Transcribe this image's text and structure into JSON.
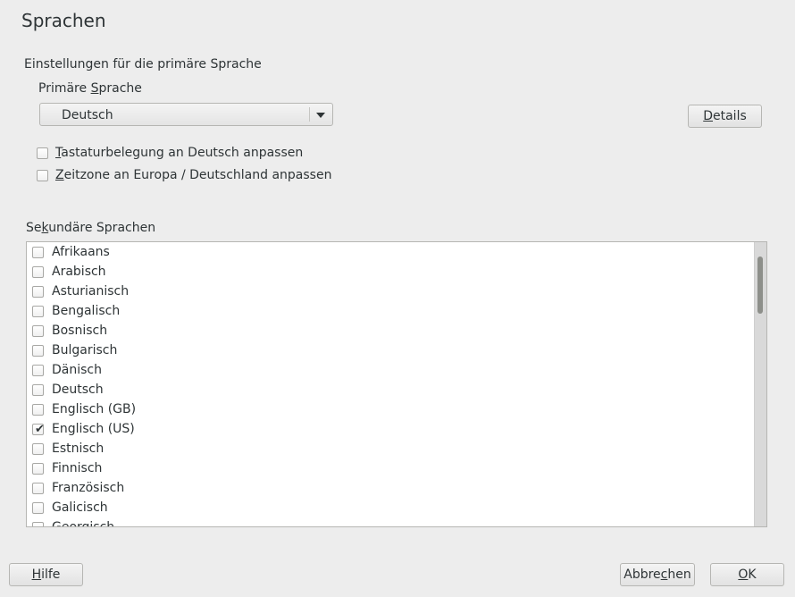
{
  "page": {
    "title": "Sprachen",
    "section_label": "Einstellungen für die primäre Sprache"
  },
  "primary": {
    "label_pre": "Primäre ",
    "label_u": "S",
    "label_post": "prache",
    "selected": "Deutsch",
    "details_u": "D",
    "details_rest": "etails"
  },
  "options": {
    "keyboard": {
      "u": "T",
      "rest": "astaturbelegung an Deutsch anpassen",
      "checked": false
    },
    "timezone": {
      "u": "Z",
      "rest": "eitzone an Europa / Deutschland anpassen",
      "checked": false
    }
  },
  "secondary": {
    "label_pre": "Se",
    "label_u": "k",
    "label_post": "undäre Sprachen",
    "items": [
      {
        "label": "Afrikaans",
        "checked": false
      },
      {
        "label": "Arabisch",
        "checked": false
      },
      {
        "label": "Asturianisch",
        "checked": false
      },
      {
        "label": "Bengalisch",
        "checked": false
      },
      {
        "label": "Bosnisch",
        "checked": false
      },
      {
        "label": "Bulgarisch",
        "checked": false
      },
      {
        "label": "Dänisch",
        "checked": false
      },
      {
        "label": "Deutsch",
        "checked": false
      },
      {
        "label": "Englisch (GB)",
        "checked": false
      },
      {
        "label": "Englisch (US)",
        "checked": true
      },
      {
        "label": "Estnisch",
        "checked": false
      },
      {
        "label": "Finnisch",
        "checked": false
      },
      {
        "label": "Französisch",
        "checked": false
      },
      {
        "label": "Galicisch",
        "checked": false
      },
      {
        "label": "Georgisch",
        "checked": false
      }
    ]
  },
  "footer": {
    "help_u": "H",
    "help_rest": "ilfe",
    "cancel_pre": "Abbre",
    "cancel_u": "c",
    "cancel_post": "hen",
    "ok_u": "O",
    "ok_rest": "K"
  }
}
